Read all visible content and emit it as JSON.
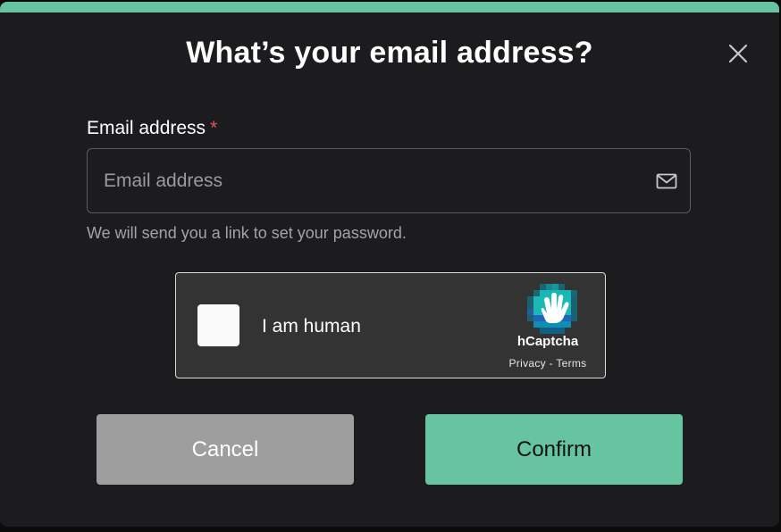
{
  "dialog": {
    "title": "What’s your email address?",
    "close_icon": "close-icon",
    "accent_color": "#66c4a0"
  },
  "email": {
    "label": "Email address",
    "required_marker": "*",
    "value": "",
    "placeholder": "Email address",
    "icon": "mail-icon",
    "helper_text": "We will send you a link to set your password."
  },
  "captcha": {
    "checkbox_label": "I am human",
    "checked": false,
    "brand": "hCaptcha",
    "privacy_link": "Privacy",
    "separator": " - ",
    "terms_link": "Terms",
    "logo_icon": "hcaptcha-logo-icon"
  },
  "actions": {
    "cancel_label": "Cancel",
    "confirm_label": "Confirm",
    "cancel_color": "#9e9e9e",
    "confirm_color": "#66c4a0"
  }
}
